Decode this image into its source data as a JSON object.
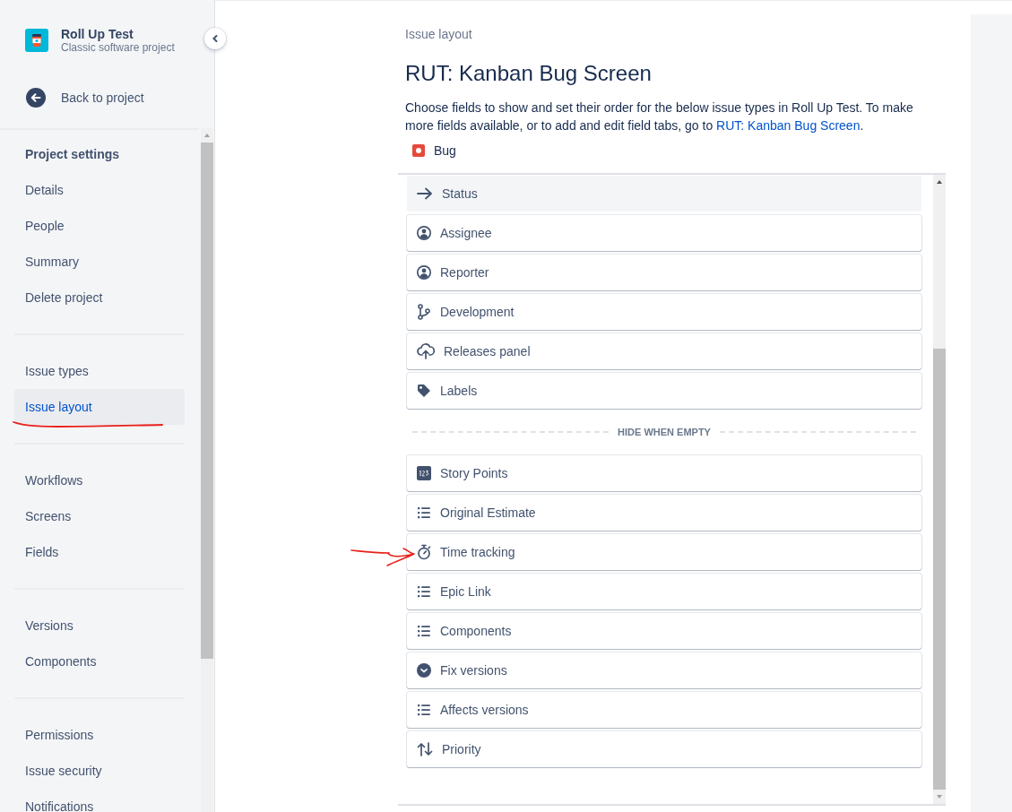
{
  "project": {
    "name": "Roll Up Test",
    "type": "Classic software project"
  },
  "back_link": "Back to project",
  "sidebar": {
    "heading": "Project settings",
    "groups": [
      {
        "items": [
          {
            "label": "Details",
            "selected": false
          },
          {
            "label": "People",
            "selected": false
          },
          {
            "label": "Summary",
            "selected": false
          },
          {
            "label": "Delete project",
            "selected": false
          }
        ]
      },
      {
        "items": [
          {
            "label": "Issue types",
            "selected": false
          },
          {
            "label": "Issue layout",
            "selected": true
          }
        ]
      },
      {
        "items": [
          {
            "label": "Workflows",
            "selected": false
          },
          {
            "label": "Screens",
            "selected": false
          },
          {
            "label": "Fields",
            "selected": false
          }
        ]
      },
      {
        "items": [
          {
            "label": "Versions",
            "selected": false
          },
          {
            "label": "Components",
            "selected": false
          }
        ]
      },
      {
        "items": [
          {
            "label": "Permissions",
            "selected": false
          },
          {
            "label": "Issue security",
            "selected": false
          },
          {
            "label": "Notifications",
            "selected": false
          }
        ]
      }
    ]
  },
  "breadcrumb": "Issue layout",
  "title": "RUT: Kanban Bug Screen",
  "description": {
    "text": "Choose fields to show and set their order for the below issue types in Roll Up Test. To make more fields available, or to add and edit field tabs, go to ",
    "link": "RUT: Kanban Bug Screen",
    "end": "."
  },
  "issue_type": "Bug",
  "fields": [
    {
      "label": "Status",
      "kind": "arrow",
      "selected": true
    },
    {
      "label": "Assignee",
      "kind": "person",
      "selected": false
    },
    {
      "label": "Reporter",
      "kind": "person",
      "selected": false
    },
    {
      "label": "Development",
      "kind": "branch",
      "selected": false
    },
    {
      "label": "Releases panel",
      "kind": "cloud",
      "selected": false
    },
    {
      "label": "Labels",
      "kind": "tag",
      "selected": false
    }
  ],
  "hidden_divider": "HIDE WHEN EMPTY",
  "hidden_fields": [
    {
      "label": "Story Points",
      "kind": "number",
      "selected": false
    },
    {
      "label": "Original Estimate",
      "kind": "list",
      "selected": false
    },
    {
      "label": "Time tracking",
      "kind": "stopwatch",
      "selected": false
    },
    {
      "label": "Epic Link",
      "kind": "list",
      "selected": false
    },
    {
      "label": "Components",
      "kind": "list",
      "selected": false
    },
    {
      "label": "Fix versions",
      "kind": "chevron",
      "selected": false
    },
    {
      "label": "Affects versions",
      "kind": "list",
      "selected": false
    },
    {
      "label": "Priority",
      "kind": "priority",
      "selected": false
    }
  ]
}
